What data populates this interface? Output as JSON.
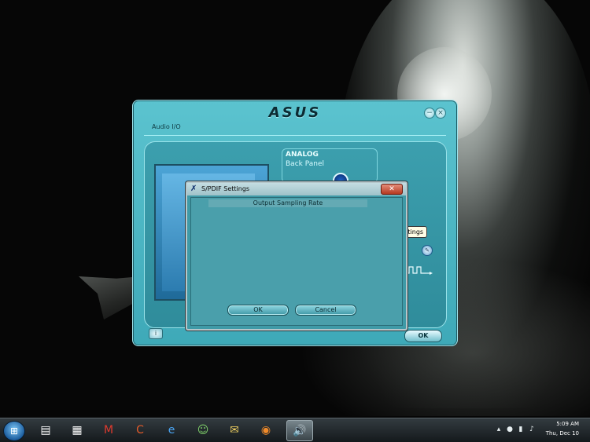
{
  "asus_window": {
    "logo": "ASUS",
    "minimize_glyph": "−",
    "close_glyph": "×",
    "tab_label": "Audio I/O",
    "analog_title": "ANALOG",
    "analog_sub": "Back Panel",
    "ok_label": "OK",
    "info_glyph": "i"
  },
  "tooltip": {
    "text": "S/PDIF Settings"
  },
  "spdif_dialog": {
    "title": "S/PDIF Settings",
    "close_glyph": "✕",
    "rate_label": "Output Sampling Rate",
    "ok_label": "OK",
    "cancel_label": "Cancel"
  },
  "taskbar": {
    "start_glyph": "⊞",
    "apps": [
      {
        "name": "windows-explorer-icon",
        "glyph": "▤"
      },
      {
        "name": "folder-icon",
        "glyph": "▦"
      },
      {
        "name": "gmail-icon",
        "glyph": "M"
      },
      {
        "name": "ccleaner-icon",
        "glyph": "C"
      },
      {
        "name": "internet-explorer-icon",
        "glyph": "e"
      },
      {
        "name": "messenger-icon",
        "glyph": "☺"
      },
      {
        "name": "mail-icon",
        "glyph": "✉"
      },
      {
        "name": "firefox-icon",
        "glyph": "◉"
      },
      {
        "name": "speaker-app-icon",
        "glyph": "🔊"
      }
    ],
    "clock_time": "5:09 AM",
    "clock_date": "Thu, Dec 10"
  },
  "colors": {
    "asus_panel": "#3ea9b8",
    "dialog_body": "#4a9fab",
    "close_red": "#c0442a"
  }
}
